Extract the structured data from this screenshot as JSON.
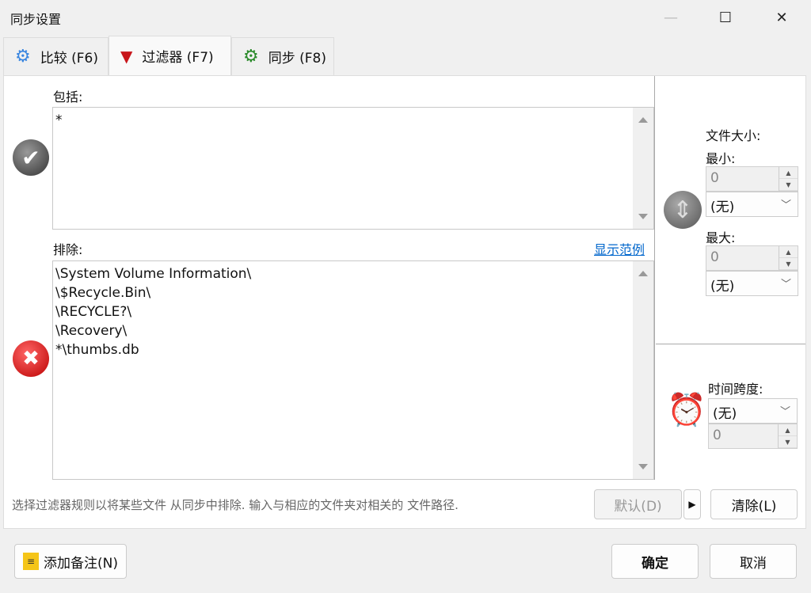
{
  "window": {
    "title": "同步设置",
    "minimize": "—",
    "maximize": "☐",
    "close": "✕"
  },
  "tabs": [
    {
      "label": "比较 (F6)",
      "icon": "gear-blue-icon"
    },
    {
      "label": "过滤器 (F7)",
      "icon": "funnel-icon"
    },
    {
      "label": "同步 (F8)",
      "icon": "gear-green-icon"
    }
  ],
  "include": {
    "label": "包括:",
    "value": "*"
  },
  "exclude": {
    "label": "排除:",
    "link": "显示范例",
    "lines": [
      "\\System Volume Information\\",
      "\\$Recycle.Bin\\",
      "\\RECYCLE?\\",
      "\\Recovery\\",
      "*\\thumbs.db"
    ]
  },
  "filesize": {
    "label": "文件大小:",
    "min_label": "最小:",
    "min_value": "0",
    "min_unit": "(无)",
    "max_label": "最大:",
    "max_value": "0",
    "max_unit": "(无)"
  },
  "timespan": {
    "label": "时间跨度:",
    "unit": "(无)",
    "value": "0"
  },
  "footer": {
    "hint": "选择过滤器规则以将某些文件 从同步中排除. 输入与相应的文件夹对相关的 文件路径.",
    "default_btn": "默认(D)",
    "clear_btn": "清除(L)"
  },
  "bottom": {
    "add_note": "添加备注(N)",
    "ok": "确定",
    "cancel": "取消"
  }
}
